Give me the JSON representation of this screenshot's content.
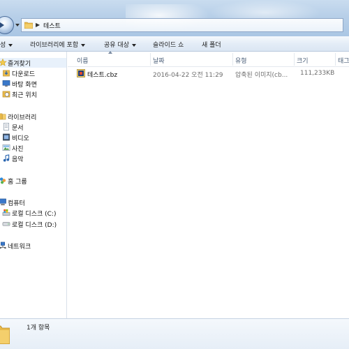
{
  "address": {
    "path": "테스트"
  },
  "toolbar": {
    "organize": "성",
    "include_library": "라이브러리에 포함",
    "share": "공유 대상",
    "slideshow": "슬라이드 쇼",
    "new_folder": "새 폴더"
  },
  "navpane": {
    "favorites": "즐겨찾기",
    "downloads": "다운로드",
    "desktop": "바탕 화면",
    "recent": "최근 위치",
    "libraries": "라이브러리",
    "documents": "문서",
    "videos": "비디오",
    "pictures": "사진",
    "music": "음악",
    "homegroup": "홈 그룹",
    "computer": "컴퓨터",
    "drive_c": "로컬 디스크 (C:)",
    "drive_d": "로컬 디스크 (D:)",
    "network": "네트워크"
  },
  "columns": {
    "name": "이름",
    "date": "날짜",
    "type": "유형",
    "size": "크기",
    "tags": "태그"
  },
  "files": [
    {
      "name": "테스트.cbz",
      "date": "2016-04-22 오전 11:29",
      "type": "압축된 이미지(cb...",
      "size": "111,233KB"
    }
  ],
  "status": {
    "item_count": "1개 항목"
  },
  "colors": {
    "accent": "#3c7fb1",
    "folder": "#e8b94a",
    "glass": "#b7cfe8"
  }
}
